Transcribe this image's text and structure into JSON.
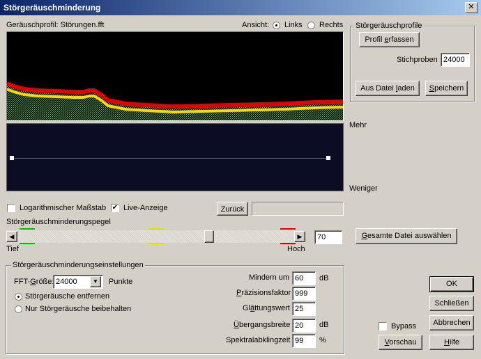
{
  "window": {
    "title": "Störgeräuschminderung",
    "close": "✕"
  },
  "profile": {
    "label": "Geräuschprofil: Störungen.fft"
  },
  "view": {
    "label": "Ansicht:",
    "left": "Links",
    "right": "Rechts"
  },
  "graph": {
    "more": "Mehr",
    "less": "Weniger"
  },
  "options": {
    "log_scale": "Logarithmischer Maßstab",
    "live": "Live-Anzeige",
    "back": "Zurück"
  },
  "level": {
    "label": "Störgeräuschminderungspegel",
    "low": "Tief",
    "high": "Hoch",
    "value": "70",
    "percent": 70
  },
  "select_all": "Gesamte Datei auswählen",
  "profiles_group": {
    "title": "Störgeräuschprofile",
    "capture": "Profil erfassen",
    "samples_label": "Stichproben",
    "samples_value": "24000",
    "load": "Aus Datei laden",
    "save": "Speichern"
  },
  "settings": {
    "title": "Störgeräuschminderungseinstellungen",
    "fft_label": "FFT-Größe:",
    "fft_value": "24000",
    "points": "Punkte",
    "remove": "Störgeräusche entfernen",
    "keep": "Nur Störgeräusche beibehalten",
    "reduce_label": "Mindern um",
    "reduce_value": "60",
    "reduce_unit": "dB",
    "precision_label": "Präzisionsfaktor",
    "precision_value": "999",
    "smoothing_label": "Glättungswert",
    "smoothing_value": "25",
    "transition_label": "Übergangsbreite",
    "transition_value": "20",
    "transition_unit": "dB",
    "spectral_label": "Spektralabklingzeit",
    "spectral_value": "99",
    "spectral_unit": "%"
  },
  "bypass": "Bypass",
  "buttons": {
    "ok": "OK",
    "close": "Schließen",
    "cancel": "Abbrechen",
    "help": "Hilfe",
    "preview": "Vorschau"
  }
}
